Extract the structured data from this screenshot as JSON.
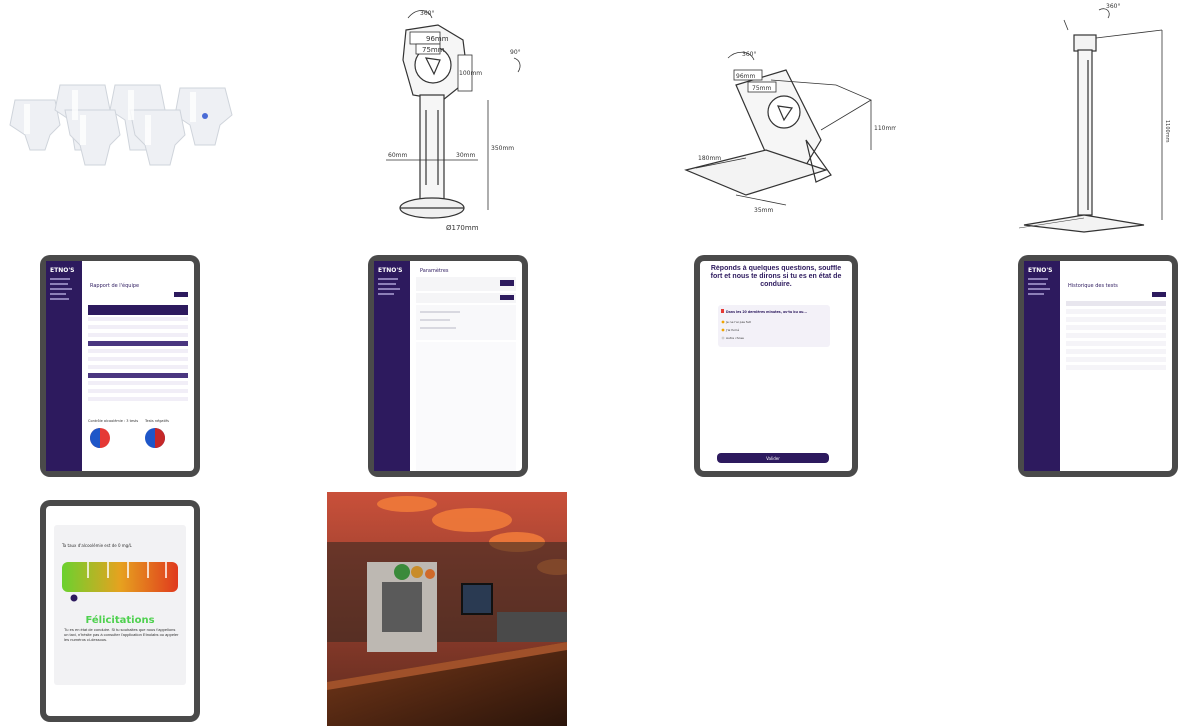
{
  "gallery": {
    "label": "Product image gallery"
  },
  "tiles": {
    "dispensers": {
      "alt": ""
    },
    "stand_front": {
      "dim_texts": [
        "96mm",
        "75mm",
        "100mm",
        "75mm",
        "350mm",
        "60mm",
        "30mm",
        "Ø170mm",
        "360°",
        "90°"
      ]
    },
    "stand_desk": {
      "dim_texts": [
        "96mm",
        "75mm",
        "100mm",
        "75mm",
        "110mm",
        "180mm",
        "35mm",
        "360°"
      ]
    },
    "floor_stand": {
      "dim_texts": [
        "360°",
        "1100mm"
      ]
    },
    "tablet_report": {
      "brand": "ETNO'S",
      "page_title": "Rapport de l'équipe",
      "left_caption": "Contrôle alcoolémie : 3 tests",
      "right_caption": "Tests négatifs"
    },
    "tablet_settings": {
      "brand": "ETNO'S",
      "page_title": "Paramètres"
    },
    "tablet_questions": {
      "heading": "Réponds à quelques questions, souffle fort et nous te dirons si tu es en état de conduire.",
      "question": "Dans les 20 dernières minutes, as-tu bu ou...",
      "options": [
        "Je ne l'ai pas fait",
        "J'ai fumé",
        "Autre chose"
      ],
      "submit": "Valider"
    },
    "tablet_history": {
      "brand": "ETNO'S",
      "page_title": "Historique des tests"
    },
    "tablet_result": {
      "intro": "Ta taux d'alcoolémie est de 0 mg/L",
      "title": "Félicitations",
      "message": "Tu es en état de conduire. Si tu souhaites que nous t'appelions un taxi, n'hésite pas à consulter l'application Etnolabs ou appeler les numéros ci-dessous."
    },
    "bar_photo": {
      "alt": ""
    }
  },
  "colors": {
    "purple": "#2d1a5e",
    "purple_light": "#4a3680",
    "gray_frame": "#4a4a4a",
    "red": "#e53935",
    "blue": "#1e56c8",
    "green": "#4fd14f",
    "meter_red": "#e03a1e",
    "meter_green": "#6bd12f"
  }
}
